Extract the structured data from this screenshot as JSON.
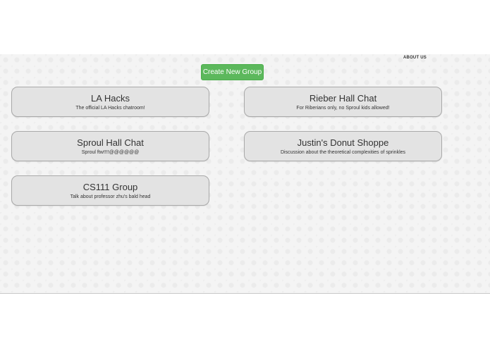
{
  "nav": {
    "about_label": "ABOUT US"
  },
  "actions": {
    "create_group_label": "Create New Group"
  },
  "groups": [
    {
      "title": "LA Hacks",
      "description": "The official LA Hacks chatroom!"
    },
    {
      "title": "Rieber Hall Chat",
      "description": "For Riberians only, no Sproul kids allowed!"
    },
    {
      "title": "Sproul Hall Chat",
      "description": "Sproul ftw!!!!@@@@@@"
    },
    {
      "title": "Justin's Donut Shoppe",
      "description": "Discussion about the theoretical complexities of sprinkles"
    },
    {
      "title": "CS111 Group",
      "description": "Talk about professor zhu's bald head"
    }
  ],
  "colors": {
    "create_button": "#5cb85c",
    "card_background": "#e3e3e3",
    "page_background": "#f4f4f4"
  }
}
